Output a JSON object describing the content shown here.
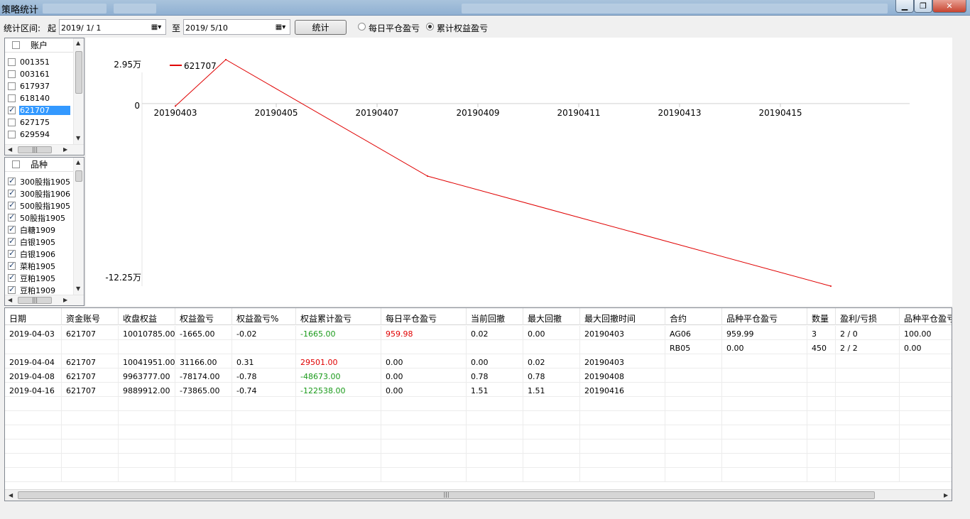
{
  "window": {
    "title": "策略统计"
  },
  "toolbar": {
    "range_label": "统计区间:",
    "from_label": "起",
    "from_date": "2019/  1/  1",
    "to_label": "至",
    "to_date": "2019/  5/10",
    "stat_button": "统计",
    "radio_daily": "每日平仓盈亏",
    "radio_cumulative": "累计权益盈亏",
    "selected_radio": "cumulative"
  },
  "accounts": {
    "header": "账户",
    "items": [
      {
        "label": "001351",
        "checked": false,
        "selected": false
      },
      {
        "label": "003161",
        "checked": false,
        "selected": false
      },
      {
        "label": "617937",
        "checked": false,
        "selected": false
      },
      {
        "label": "618140",
        "checked": false,
        "selected": false
      },
      {
        "label": "621707",
        "checked": true,
        "selected": true
      },
      {
        "label": "627175",
        "checked": false,
        "selected": false
      },
      {
        "label": "629594",
        "checked": false,
        "selected": false
      }
    ]
  },
  "products": {
    "header": "品种",
    "items": [
      {
        "label": "300股指1905",
        "checked": true
      },
      {
        "label": "300股指1906",
        "checked": true
      },
      {
        "label": "500股指1905",
        "checked": true
      },
      {
        "label": "50股指1905",
        "checked": true
      },
      {
        "label": "白糖1909",
        "checked": true
      },
      {
        "label": "白银1905",
        "checked": true
      },
      {
        "label": "白银1906",
        "checked": true
      },
      {
        "label": "菜粕1905",
        "checked": true
      },
      {
        "label": "豆粕1905",
        "checked": true
      },
      {
        "label": "豆粕1909",
        "checked": true
      }
    ]
  },
  "chart_data": {
    "type": "line",
    "series": [
      {
        "name": "621707",
        "color": "#e00000",
        "points": [
          {
            "x": "20190403",
            "y": -1665
          },
          {
            "x": "20190404",
            "y": 29501
          },
          {
            "x": "20190408",
            "y": -48673
          },
          {
            "x": "20190416",
            "y": -122538
          }
        ]
      }
    ],
    "x_tick_labels": [
      "20190403",
      "20190405",
      "20190407",
      "20190409",
      "20190411",
      "20190413",
      "20190415"
    ],
    "y_tick_labels": {
      "top": "2.95万",
      "zero": "0",
      "bottom": "-12.25万"
    },
    "ylim": [
      -122538,
      29501
    ],
    "legend_position": "top-left"
  },
  "grid": {
    "columns": [
      "日期",
      "资金账号",
      "收盘权益",
      "权益盈亏",
      "权益盈亏%",
      "权益累计盈亏",
      "每日平仓盈亏",
      "当前回撤",
      "最大回撤",
      "最大回撤时间",
      "合约",
      "品种平仓盈亏",
      "数量",
      "盈利/亏损",
      "品种平仓盈亏"
    ],
    "rows": [
      [
        "2019-04-03",
        "621707",
        "10010785.00",
        "-1665.00",
        "-0.02",
        "-1665.00",
        "959.98",
        "0.02",
        "0.00",
        "20190403",
        "AG06",
        "959.99",
        "3",
        "2 / 0",
        "100.00"
      ],
      [
        "",
        "",
        "",
        "",
        "",
        "",
        "",
        "",
        "",
        "",
        "RB05",
        "0.00",
        "450",
        "2 / 2",
        "0.00"
      ],
      [
        "2019-04-04",
        "621707",
        "10041951.00",
        "31166.00",
        "0.31",
        "29501.00",
        "0.00",
        "0.00",
        "0.02",
        "20190403",
        "",
        "",
        "",
        "",
        ""
      ],
      [
        "2019-04-08",
        "621707",
        "9963777.00",
        "-78174.00",
        "-0.78",
        "-48673.00",
        "0.00",
        "0.78",
        "0.78",
        "20190408",
        "",
        "",
        "",
        "",
        ""
      ],
      [
        "2019-04-16",
        "621707",
        "9889912.00",
        "-73865.00",
        "-0.74",
        "-122538.00",
        "0.00",
        "1.51",
        "1.51",
        "20190416",
        "",
        "",
        "",
        "",
        ""
      ]
    ],
    "cell_colors": {
      "red": "#e00000",
      "green": "#1a9a1a"
    }
  }
}
